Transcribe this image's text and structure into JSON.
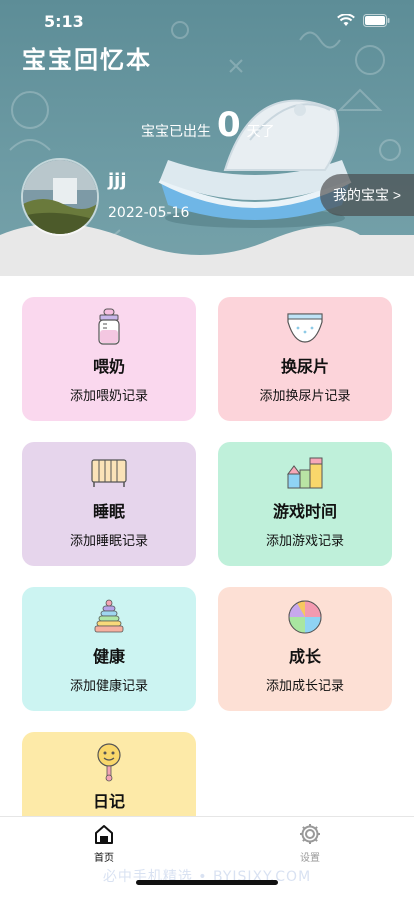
{
  "status_bar": {
    "time": "5:13"
  },
  "header": {
    "app_title": "宝宝回忆本",
    "born_prefix": "宝宝已出生",
    "days": "0",
    "days_suffix": "天了",
    "baby_name": "jjj",
    "birth_date": "2022-05-16",
    "my_baby_label": "我的宝宝 >"
  },
  "cards": [
    {
      "title": "喂奶",
      "subtitle": "添加喂奶记录",
      "icon": "baby-bottle-icon",
      "color": "#fad8ee"
    },
    {
      "title": "换尿片",
      "subtitle": "添加换尿片记录",
      "icon": "diaper-icon",
      "color": "#fcd4da"
    },
    {
      "title": "睡眠",
      "subtitle": "添加睡眠记录",
      "icon": "crib-icon",
      "color": "#e6d5ec"
    },
    {
      "title": "游戏时间",
      "subtitle": "添加游戏记录",
      "icon": "toy-blocks-icon",
      "color": "#bff0da"
    },
    {
      "title": "健康",
      "subtitle": "添加健康记录",
      "icon": "ring-stacker-icon",
      "color": "#ccf4f2"
    },
    {
      "title": "成长",
      "subtitle": "添加成长记录",
      "icon": "ball-icon",
      "color": "#fde0d5"
    },
    {
      "title": "日记",
      "subtitle": "",
      "icon": "rattle-icon",
      "color": "#fdeaa8"
    }
  ],
  "tabbar": {
    "home_label": "首页",
    "settings_label": "设置"
  },
  "watermark": "必中手机精选 • BYJSJXY.COM"
}
